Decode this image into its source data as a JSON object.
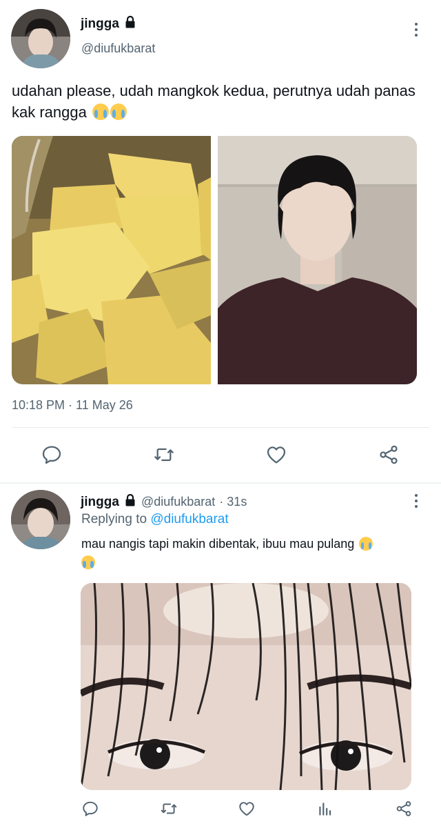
{
  "tweet": {
    "display_name": "jingga",
    "handle": "@diufukbarat",
    "text": "udahan please, udah mangkok kedua, perutnya udah panas kak rangga",
    "timestamp": "10:18 PM · 11 May 26",
    "icons": {
      "lock": "lock-icon",
      "more": "more-vertical-icon",
      "reply": "reply-icon",
      "retweet": "retweet-icon",
      "like": "heart-icon",
      "share": "share-icon"
    }
  },
  "reply": {
    "display_name": "jingga",
    "handle": "@diufukbarat",
    "time": "· 31s",
    "replying_prefix": "Replying to",
    "replying_handle": "@diufukbarat",
    "text": "mau nangis tapi makin dibentak, ibuu mau pulang",
    "icons": {
      "reply": "reply-icon",
      "retweet": "retweet-icon",
      "like": "heart-icon",
      "analytics": "analytics-icon",
      "share": "share-icon"
    }
  },
  "colors": {
    "text": "#0f1419",
    "secondary": "#536471",
    "link": "#1d9bf0",
    "divider": "#e6e9ec"
  }
}
